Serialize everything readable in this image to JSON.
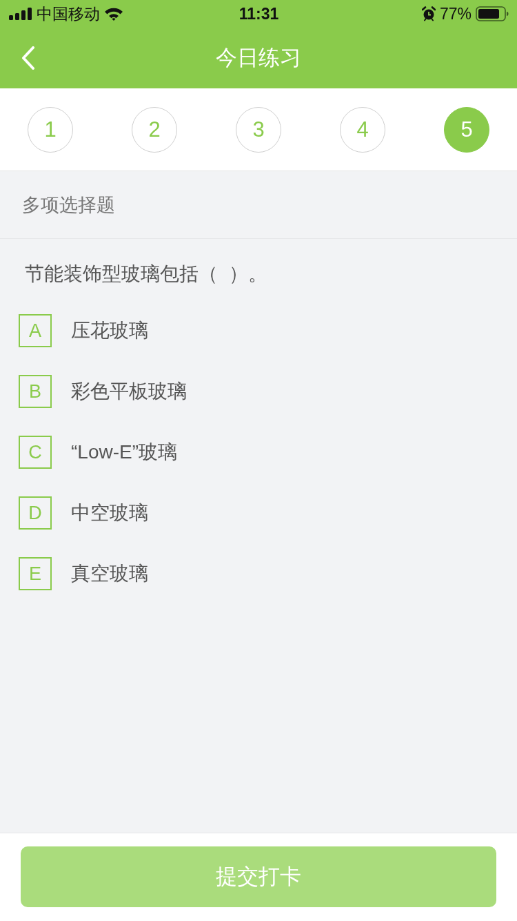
{
  "status_bar": {
    "carrier": "中国移动",
    "time": "11:31",
    "battery": "77%"
  },
  "nav_bar": {
    "title": "今日练习"
  },
  "question_tabs": [
    {
      "label": "1",
      "selected": false
    },
    {
      "label": "2",
      "selected": false
    },
    {
      "label": "3",
      "selected": false
    },
    {
      "label": "4",
      "selected": false
    },
    {
      "label": "5",
      "selected": true
    }
  ],
  "section": {
    "label": "多项选择题"
  },
  "question": {
    "text": "节能装饰型玻璃包括（  ）。",
    "options": [
      {
        "letter": "A",
        "text": "压花玻璃",
        "selected": false
      },
      {
        "letter": "B",
        "text": "彩色平板玻璃",
        "selected": false
      },
      {
        "letter": "C",
        "text": "“Low-E”玻璃",
        "selected": false
      },
      {
        "letter": "D",
        "text": "中空玻璃",
        "selected": false
      },
      {
        "letter": "E",
        "text": "真空玻璃",
        "selected": false
      }
    ]
  },
  "submit_button": {
    "label": "提交打卡",
    "disabled": true
  }
}
